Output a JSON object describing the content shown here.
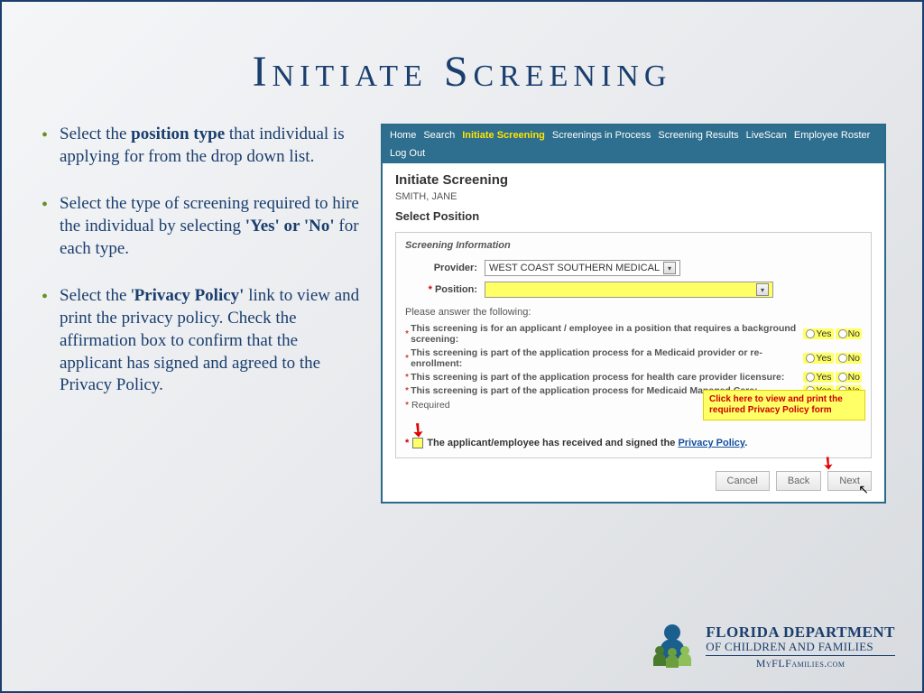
{
  "title": "Initiate Screening",
  "bullets": [
    {
      "pre": "Select the ",
      "b": "position type",
      "post": " that individual is applying for from the drop down list."
    },
    {
      "pre": "Select the type of screening required to hire the individual  by selecting ",
      "b": "'Yes' or 'No'",
      "post": " for each type."
    },
    {
      "pre": "Select the '",
      "b": "Privacy Policy'",
      "post": " link to view and print the privacy policy.  Check the affirmation box to confirm that the applicant has signed and agreed to the Privacy Policy."
    }
  ],
  "nav": [
    "Home",
    "Search",
    "Initiate Screening",
    "Screenings in Process",
    "Screening Results",
    "LiveScan",
    "Employee Roster",
    "Log Out"
  ],
  "nav_active_index": 2,
  "app": {
    "page_title": "Initiate Screening",
    "person": "SMITH, JANE",
    "subhead": "Select Position",
    "panel_title": "Screening Information",
    "provider_label": "Provider:",
    "provider_value": "WEST COAST SOUTHERN MEDICAL",
    "position_label": "Position:",
    "position_value": "",
    "instructions": "Please answer the following:",
    "questions": [
      "This screening is for an applicant / employee in a position that requires a background screening:",
      "This screening is part of the application process for a Medicaid provider or re-enrollment:",
      "This screening is part of the application process for health care provider licensure:",
      "This screening is part of the application process for Medicaid Managed Care:"
    ],
    "yes": "Yes",
    "no": "No",
    "required_note": "Required",
    "callout": "Click here to view and print the required Privacy Policy form",
    "affirm_pre": "The applicant/employee has received and signed the ",
    "affirm_link": "Privacy Policy",
    "affirm_post": ".",
    "buttons": {
      "cancel": "Cancel",
      "back": "Back",
      "next": "Next"
    }
  },
  "footer": {
    "l1": "FLORIDA DEPARTMENT",
    "l2": "OF CHILDREN AND FAMILIES",
    "l3": "MyFLFamilies.com"
  }
}
